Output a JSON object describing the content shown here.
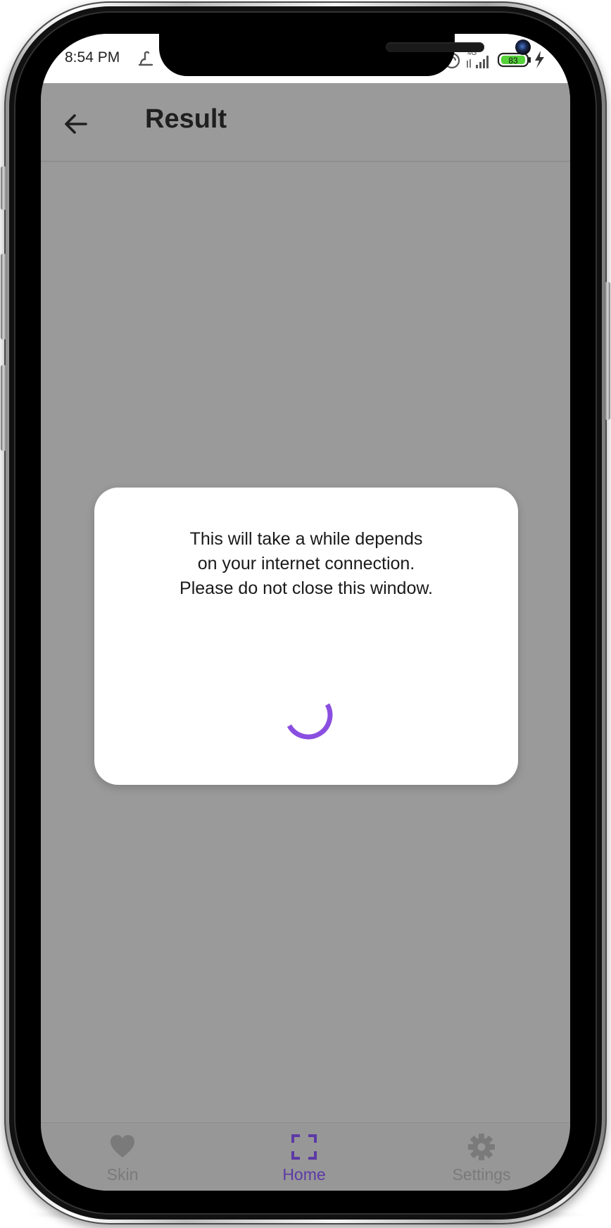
{
  "status_bar": {
    "time": "8:54 PM",
    "network": "4G",
    "battery": "83"
  },
  "app_bar": {
    "title": "Result",
    "back_icon": "arrow-left-icon"
  },
  "dialog": {
    "lines": [
      "This will take a while depends",
      "on your internet connection.",
      "Please do not close this window."
    ],
    "spinner_color": "#8a4fe0"
  },
  "bottom_nav": {
    "items": [
      {
        "label": "Skin",
        "icon": "heart-icon",
        "active": false
      },
      {
        "label": "Home",
        "icon": "scan-frame-icon",
        "active": true
      },
      {
        "label": "Settings",
        "icon": "gear-icon",
        "active": false
      }
    ],
    "active_color": "#5c3aa6",
    "inactive_color": "#7a7a7a"
  },
  "colors": {
    "scrim": "#9a9a9a",
    "dialog_bg": "#ffffff"
  }
}
